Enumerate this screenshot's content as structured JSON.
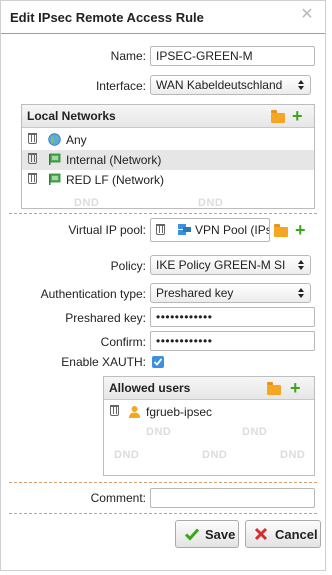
{
  "dialog": {
    "title": "Edit IPsec Remote Access Rule",
    "close_icon": "close-icon"
  },
  "name": {
    "label": "Name:",
    "value": "IPSEC-GREEN-M"
  },
  "interface": {
    "label": "Interface:",
    "value": "WAN Kabeldeutschland"
  },
  "local_networks": {
    "title": "Local Networks",
    "items": [
      {
        "label": "Any",
        "icon": "globe-icon"
      },
      {
        "label": "Internal (Network)",
        "icon": "network-icon"
      },
      {
        "label": "RED LF (Network)",
        "icon": "network-icon"
      }
    ],
    "dnd": "DND"
  },
  "virtual_ip_pool": {
    "label": "Virtual IP pool:",
    "value": "VPN Pool (IPsec)"
  },
  "policy": {
    "label": "Policy:",
    "value": "IKE Policy GREEN-M SI"
  },
  "auth_type": {
    "label": "Authentication type:",
    "value": "Preshared key"
  },
  "preshared_key": {
    "label": "Preshared key:",
    "value": "••••••••••••"
  },
  "confirm": {
    "label": "Confirm:",
    "value": "••••••••••••"
  },
  "xauth": {
    "label": "Enable XAUTH:",
    "checked": true
  },
  "allowed_users": {
    "title": "Allowed users",
    "items": [
      {
        "label": "fgrueb-ipsec",
        "icon": "user-icon"
      }
    ],
    "dnd": "DND"
  },
  "comment": {
    "label": "Comment:",
    "value": ""
  },
  "buttons": {
    "save": "Save",
    "cancel": "Cancel"
  },
  "colors": {
    "accent": "#f28c2b",
    "plus": "#3aa61a",
    "folder": "#f5a623",
    "check": "#3d8fe0"
  }
}
